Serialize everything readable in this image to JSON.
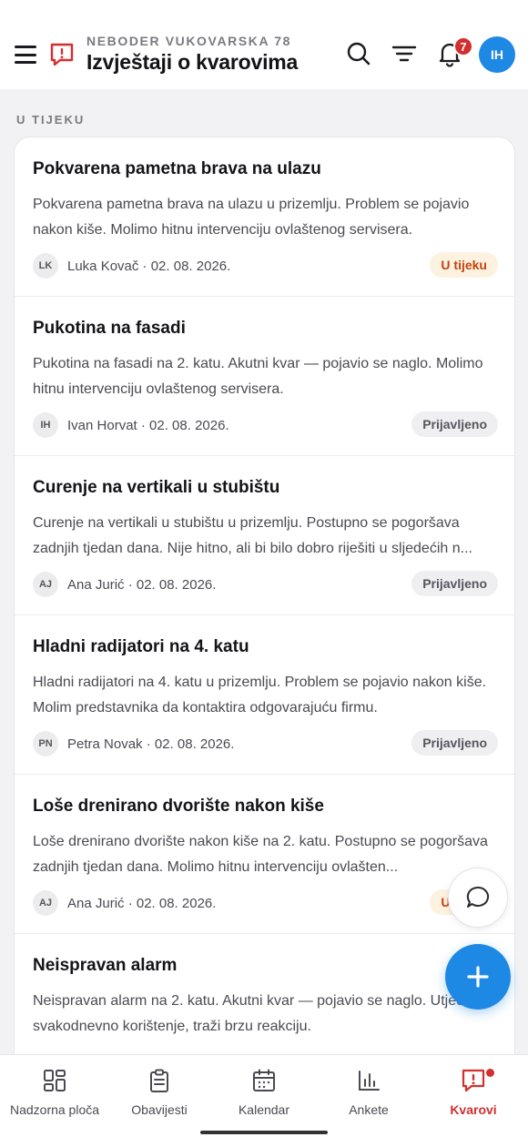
{
  "header": {
    "subtitle": "NEBODER VUKOVARSKA 78",
    "title": "Izvještaji o kvarovima",
    "notification_count": "7",
    "user_initials": "IH"
  },
  "section": {
    "label": "U TIJEKU"
  },
  "reports": [
    {
      "title": "Pokvarena pametna brava na ulazu",
      "description": "Pokvarena pametna brava na ulazu u prizemlju. Problem se pojavio nakon kiše. Molimo hitnu intervenciju ovlaštenog servisera.",
      "initials": "LK",
      "meta": "Luka Kovač · 02. 08. 2026.",
      "status": "U tijeku"
    },
    {
      "title": "Pukotina na fasadi",
      "description": "Pukotina na fasadi na 2. katu. Akutni kvar — pojavio se naglo. Molimo hitnu intervenciju ovlaštenog servisera.",
      "initials": "IH",
      "meta": "Ivan Horvat · 02. 08. 2026.",
      "status": "Prijavljeno"
    },
    {
      "title": "Curenje na vertikali u stubištu",
      "description": "Curenje na vertikali u stubištu u prizemlju. Postupno se pogoršava zadnjih tjedan dana. Nije hitno, ali bi bilo dobro riješiti u sljedećih n...",
      "initials": "AJ",
      "meta": "Ana Jurić · 02. 08. 2026.",
      "status": "Prijavljeno"
    },
    {
      "title": "Hladni radijatori na 4. katu",
      "description": "Hladni radijatori na 4. katu u prizemlju. Problem se pojavio nakon kiše. Molim predstavnika da kontaktira odgovarajuću firmu.",
      "initials": "PN",
      "meta": "Petra Novak · 02. 08. 2026.",
      "status": "Prijavljeno"
    },
    {
      "title": "Loše drenirano dvorište nakon kiše",
      "description": "Loše drenirano dvorište nakon kiše na 2. katu. Postupno se pogoršava zadnjih tjedan dana. Molimo hitnu intervenciju ovlašten...",
      "initials": "AJ",
      "meta": "Ana Jurić · 02. 08. 2026.",
      "status": "U tijeku"
    },
    {
      "title": "Neispravan alarm",
      "description": "Neispravan alarm na 2. katu. Akutni kvar — pojavio se naglo. Utječe na svakodnevno korištenje, traži brzu reakciju.",
      "initials": "",
      "meta": "",
      "status": ""
    }
  ],
  "nav": {
    "items": [
      {
        "label": "Nadzorna ploča",
        "icon": "dashboard-icon"
      },
      {
        "label": "Obavijesti",
        "icon": "clipboard-icon"
      },
      {
        "label": "Kalendar",
        "icon": "calendar-icon"
      },
      {
        "label": "Ankete",
        "icon": "bar-chart-icon"
      },
      {
        "label": "Kvarovi",
        "icon": "alert-message-icon"
      }
    ],
    "active": "Kvarovi"
  },
  "colors": {
    "accent_blue": "#1e88e5",
    "alert_red": "#d32f2f",
    "in_progress_bg": "#fdf1e0",
    "in_progress_text": "#c1440e"
  }
}
